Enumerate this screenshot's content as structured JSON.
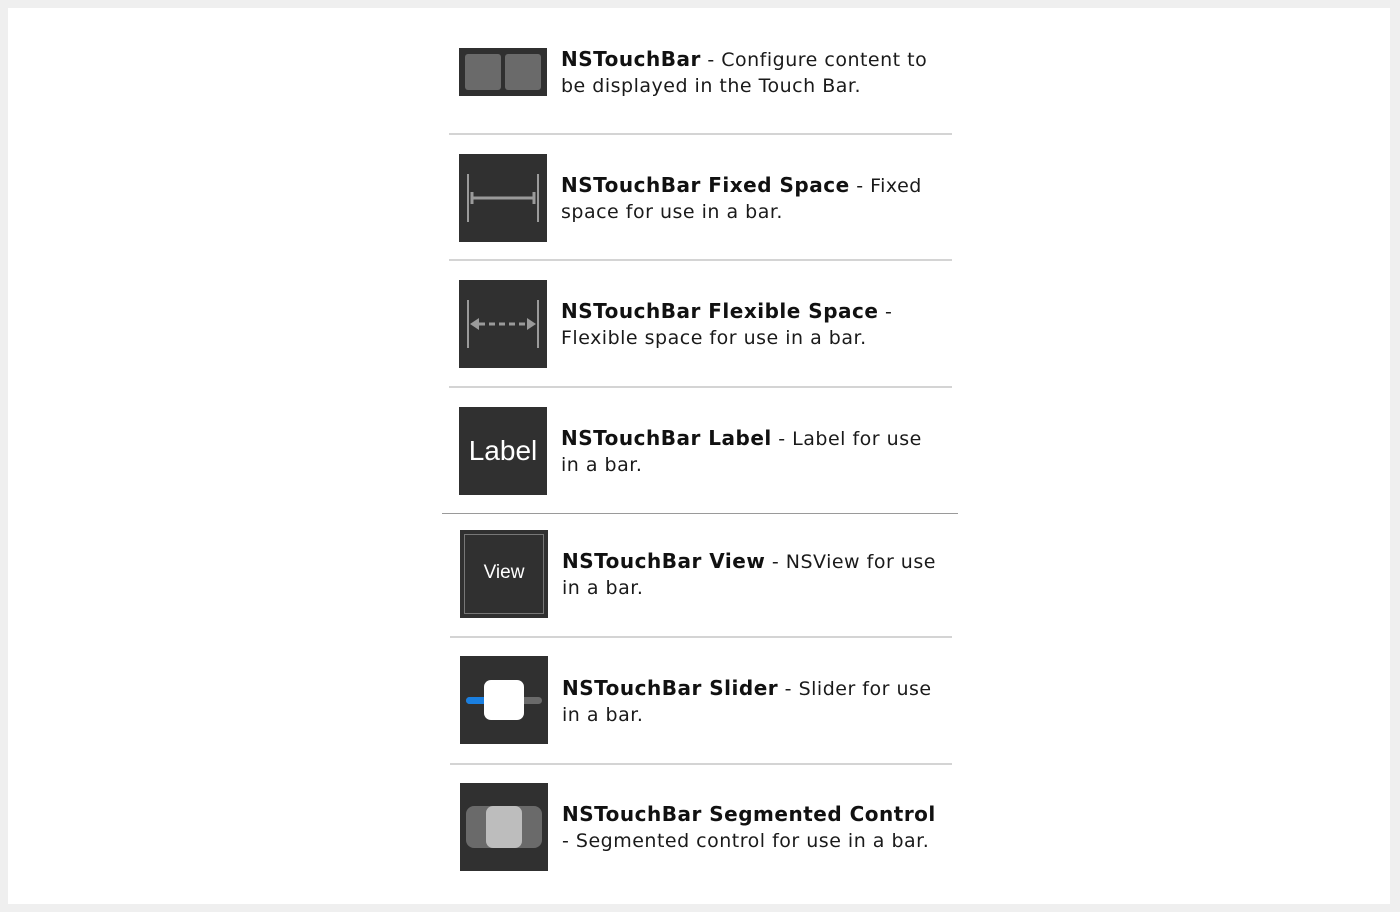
{
  "items": [
    {
      "title": "NSTouchBar",
      "description": " - Configure content to be displayed in the Touch Bar.",
      "icon": "touchbar-icon"
    },
    {
      "title": "NSTouchBar Fixed Space",
      "description": " - Fixed space for use in a bar.",
      "icon": "fixed-space-icon"
    },
    {
      "title": "NSTouchBar Flexible Space",
      "description": " - Flexible space for use in a bar.",
      "icon": "flexible-space-icon"
    },
    {
      "title": "NSTouchBar Label",
      "description": " - Label for use in a bar.",
      "icon": "label-icon",
      "icon_text": "Label"
    },
    {
      "title": "NSTouchBar View",
      "description": " - NSView for use in a bar.",
      "icon": "view-icon",
      "icon_text": "View"
    },
    {
      "title": "NSTouchBar Slider",
      "description": " - Slider for use in a bar.",
      "icon": "slider-icon"
    },
    {
      "title": "NSTouchBar Segmented Control",
      "description": " - Segmented control for use in a bar.",
      "icon": "segmented-control-icon"
    }
  ],
  "colors": {
    "icon_background": "#303030",
    "slider_fill": "#1a7fe0",
    "separator": "#d4d4d4"
  }
}
